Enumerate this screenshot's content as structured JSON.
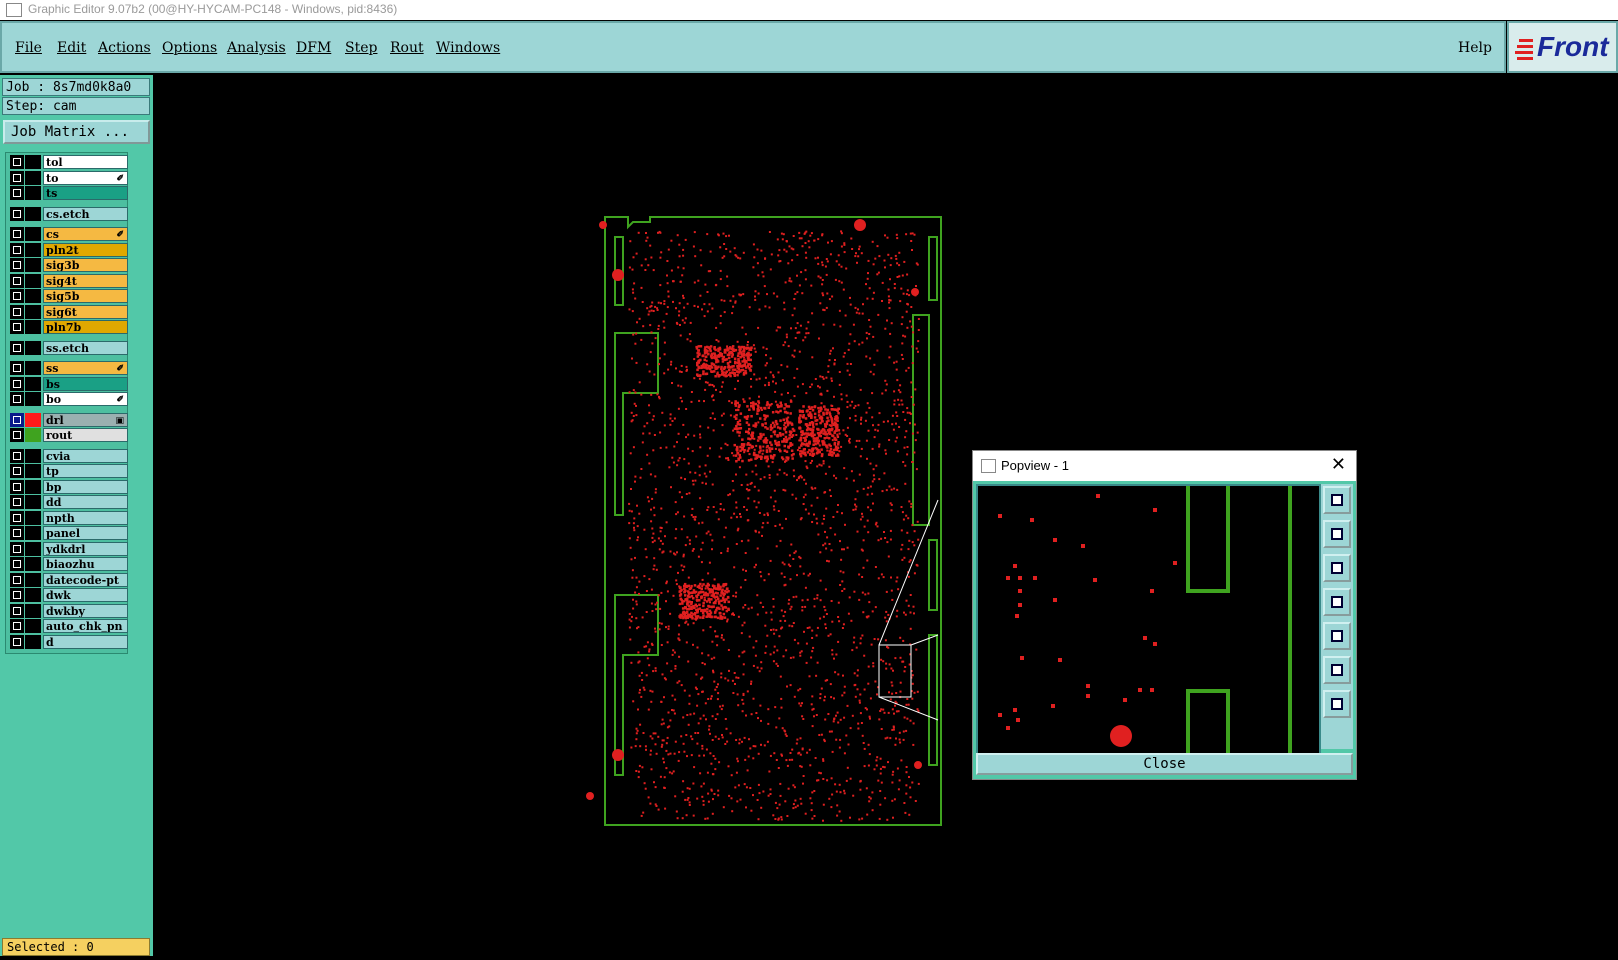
{
  "window": {
    "title": "Graphic Editor 9.07b2 (00@HY-HYCAM-PC148 - Windows, pid:8436)"
  },
  "menubar": {
    "items": [
      "File",
      "Edit",
      "Actions",
      "Options",
      "Analysis",
      "DFM",
      "Step",
      "Rout",
      "Windows"
    ],
    "help": "Help",
    "logo": "Front"
  },
  "job": {
    "job_text": "Job : 8s7md0k8a0",
    "step_text": "Step: cam",
    "matrix_button": "Job Matrix ..."
  },
  "layers": [
    {
      "name": "tol",
      "color": "#ffffff"
    },
    {
      "name": "to",
      "color": "#ffffff",
      "mark": "✐"
    },
    {
      "name": "ts",
      "color": "#1aa085"
    },
    {
      "name": "cs.etch",
      "color": "#9dd6d6"
    },
    {
      "name": "cs",
      "color": "#f5b942",
      "mark": "✐"
    },
    {
      "name": "pln2t",
      "color": "#e0a800"
    },
    {
      "name": "sig3b",
      "color": "#f5b942"
    },
    {
      "name": "sig4t",
      "color": "#f5b942"
    },
    {
      "name": "sig5b",
      "color": "#f5b942"
    },
    {
      "name": "sig6t",
      "color": "#f5b942"
    },
    {
      "name": "pln7b",
      "color": "#e0a800"
    },
    {
      "name": "ss.etch",
      "color": "#9dd6d6"
    },
    {
      "name": "ss",
      "color": "#f5b942",
      "mark": "✐"
    },
    {
      "name": "bs",
      "color": "#1aa085"
    },
    {
      "name": "bo",
      "color": "#ffffff",
      "mark": "✐"
    },
    {
      "name": "drl",
      "color": "#9ab0b0",
      "swatch": "#ff1a1a",
      "active": true,
      "mark": "▣"
    },
    {
      "name": "rout",
      "color": "#e0e0e0",
      "swatch": "#3fa31f"
    },
    {
      "name": "cvia",
      "color": "#9dd6d6"
    },
    {
      "name": "tp",
      "color": "#9dd6d6"
    },
    {
      "name": "bp",
      "color": "#9dd6d6"
    },
    {
      "name": "dd",
      "color": "#9dd6d6"
    },
    {
      "name": "npth",
      "color": "#9dd6d6"
    },
    {
      "name": "panel",
      "color": "#9dd6d6"
    },
    {
      "name": "ydkdrl",
      "color": "#9dd6d6"
    },
    {
      "name": "biaozhu",
      "color": "#9dd6d6"
    },
    {
      "name": "datecode-pt",
      "color": "#9dd6d6"
    },
    {
      "name": "dwk",
      "color": "#9dd6d6"
    },
    {
      "name": "dwkby",
      "color": "#9dd6d6"
    },
    {
      "name": "auto_chk_pn",
      "color": "#9dd6d6"
    },
    {
      "name": "d",
      "color": "#9dd6d6"
    }
  ],
  "status": {
    "text": "Selected : 0"
  },
  "popview": {
    "title": "Popview - 1",
    "close_label": "Close"
  },
  "colors": {
    "outline": "#3fa31f",
    "drill": "#e02020",
    "panel": "#52c8a8"
  }
}
